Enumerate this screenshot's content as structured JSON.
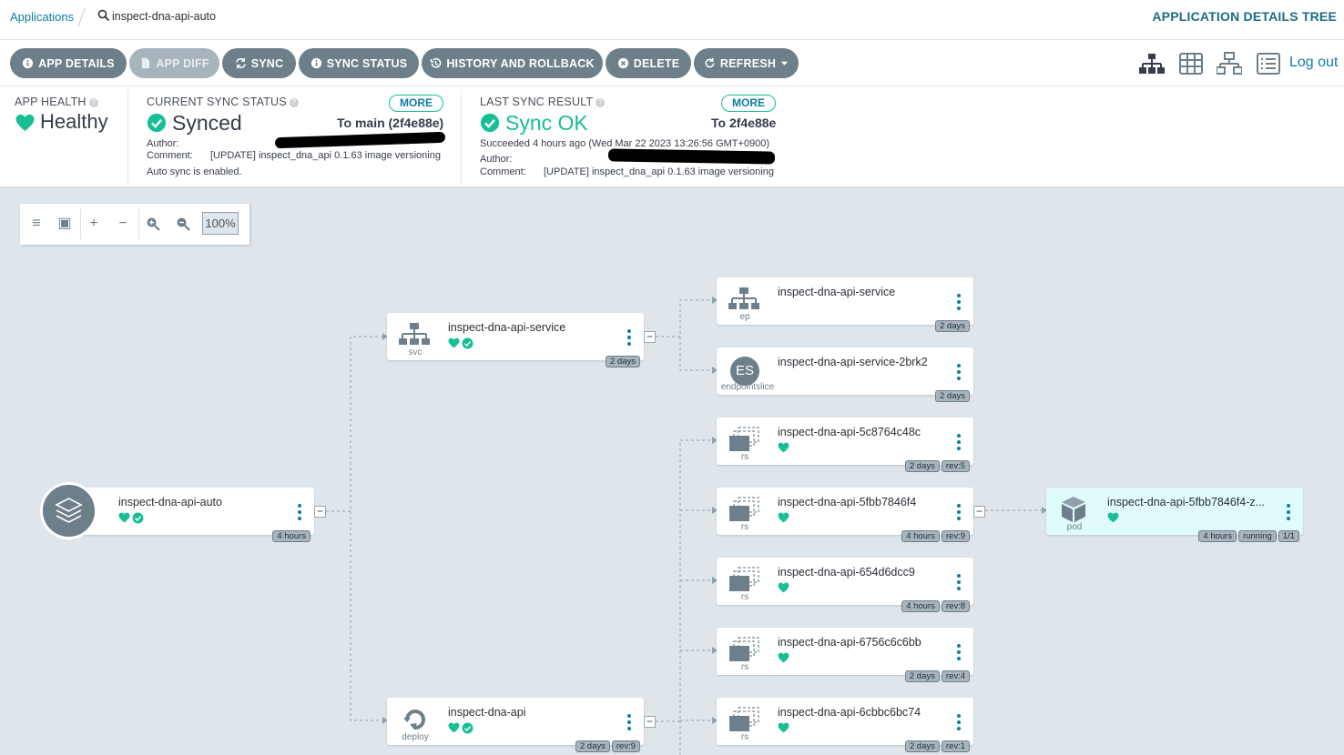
{
  "breadcrumb": {
    "apps": "Applications",
    "current": "inspect-dna-api-auto"
  },
  "view_title": "APPLICATION DETAILS TREE",
  "toolbar": {
    "app_details": "APP DETAILS",
    "app_diff": "APP DIFF",
    "sync": "SYNC",
    "sync_status": "SYNC STATUS",
    "history": "HISTORY AND ROLLBACK",
    "delete": "DELETE",
    "refresh": "REFRESH",
    "logout": "Log out"
  },
  "health": {
    "label": "APP HEALTH",
    "value": "Healthy"
  },
  "sync_status": {
    "label": "CURRENT SYNC STATUS",
    "value": "Synced",
    "more": "MORE",
    "target": "To main (2f4e88e)",
    "author_label": "Author:",
    "comment_label": "Comment:",
    "comment": "[UPDATE] inspect_dna_api 0.1.63 image versioning",
    "auto_sync": "Auto sync is enabled."
  },
  "last_sync": {
    "label": "LAST SYNC RESULT",
    "value": "Sync OK",
    "more": "MORE",
    "target": "To 2f4e88e",
    "succeeded": "Succeeded 4 hours ago (Wed Mar 22 2023 13:26:56 GMT+0900)",
    "author_label": "Author:",
    "comment_label": "Comment:",
    "comment": "[UPDATE] inspect_dna_api 0.1.63 image versioning"
  },
  "zoom": {
    "value": "100%"
  },
  "colors": {
    "accent": "#0d7ea0",
    "healthy": "#18be94",
    "button": "#6d7f8b",
    "canvas": "#dee6eb"
  },
  "nodes": {
    "app": {
      "name": "inspect-dna-api-auto",
      "age": "4 hours"
    },
    "svc": {
      "name": "inspect-dna-api-service",
      "kind": "svc",
      "age": "2 days"
    },
    "deploy": {
      "name": "inspect-dna-api",
      "kind": "deploy",
      "age": "2 days",
      "rev": "rev:9"
    },
    "ep": {
      "name": "inspect-dna-api-service",
      "kind": "ep",
      "age": "2 days"
    },
    "es": {
      "name": "inspect-dna-api-service-2brk2",
      "kind": "endpointslice",
      "icon_text": "ES",
      "age": "2 days"
    },
    "rs1": {
      "name": "inspect-dna-api-5c8764c48c",
      "kind": "rs",
      "age": "2 days",
      "rev": "rev:5"
    },
    "rs2": {
      "name": "inspect-dna-api-5fbb7846f4",
      "kind": "rs",
      "age": "4 hours",
      "rev": "rev:9"
    },
    "rs3": {
      "name": "inspect-dna-api-654d6dcc9",
      "kind": "rs",
      "age": "4 hours",
      "rev": "rev:8"
    },
    "rs4": {
      "name": "inspect-dna-api-6756c6c6bb",
      "kind": "rs",
      "age": "2 days",
      "rev": "rev:4"
    },
    "rs5": {
      "name": "inspect-dna-api-6cbbc6bc74",
      "kind": "rs",
      "age": "2 days",
      "rev": "rev:1"
    },
    "pod": {
      "name": "inspect-dna-api-5fbb7846f4-z...",
      "kind": "pod",
      "age": "4 hours",
      "status": "running",
      "ready": "1/1"
    }
  }
}
